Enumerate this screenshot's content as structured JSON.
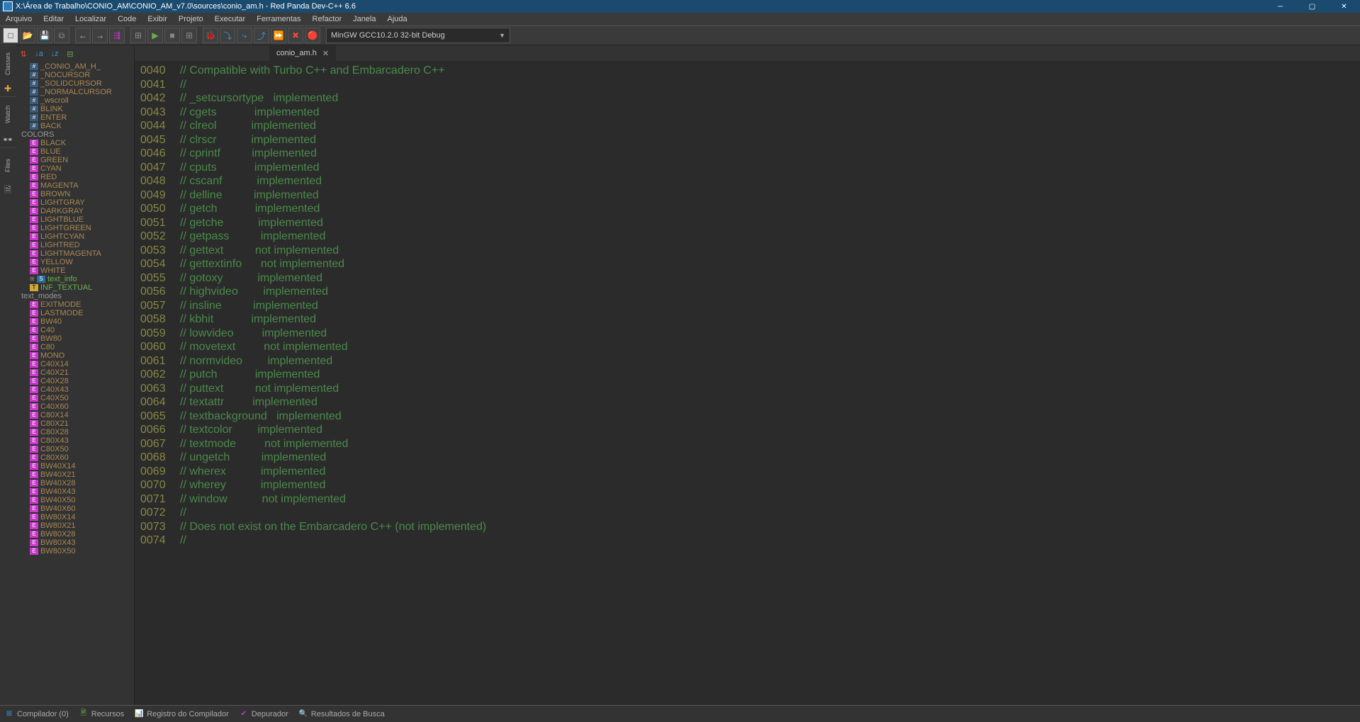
{
  "title": "X:\\Área de Trabalho\\CONIO_AM\\CONIO_AM_v7.0\\sources\\conio_am.h - Red Panda Dev-C++ 6.6",
  "menus": [
    "Arquivo",
    "Editar",
    "Localizar",
    "Code",
    "Exibir",
    "Projeto",
    "Executar",
    "Ferramentas",
    "Refactor",
    "Janela",
    "Ajuda"
  ],
  "compiler_combo": "MinGW GCC10.2.0 32-bit Debug",
  "vtabs": [
    "Classes",
    "Watch",
    "Files"
  ],
  "tree_defines": [
    " _CONIO_AM_H_",
    "_NOCURSOR",
    "_SOLIDCURSOR",
    "_NORMALCURSOR",
    "_wscroll",
    "BLINK",
    "ENTER",
    "BACK"
  ],
  "tree_enum_header": "COLORS",
  "tree_colors": [
    "BLACK",
    "BLUE",
    "GREEN",
    "CYAN",
    "RED",
    "MAGENTA",
    "BROWN",
    "LIGHTGRAY",
    "DARKGRAY",
    "LIGHTBLUE",
    "LIGHTGREEN",
    "LIGHTCYAN",
    "LIGHTRED",
    "LIGHTMAGENTA",
    "YELLOW",
    "WHITE"
  ],
  "tree_structs": [
    {
      "name": "text_info",
      "icon": "s",
      "expandable": true
    },
    {
      "name": "INF_TEXTUAL",
      "icon": "t",
      "expandable": false
    }
  ],
  "tree_textmodes_header": "text_modes",
  "tree_textmodes": [
    "EXITMODE",
    "LASTMODE",
    "BW40",
    "C40",
    "BW80",
    "C80",
    "MONO",
    "C40X14",
    "C40X21",
    "C40X28",
    "C40X43",
    "C40X50",
    "C40X60",
    "C80X14",
    "C80X21",
    "C80X28",
    "C80X43",
    "C80X50",
    "C80X60",
    "BW40X14",
    "BW40X21",
    "BW40X28",
    "BW40X43",
    "BW40X50",
    "BW40X60",
    "BW80X14",
    "BW80X21",
    "BW80X28",
    "BW80X43",
    "BW80X50"
  ],
  "tab_name": "conio_am.h",
  "code_lines": [
    {
      "n": "0040",
      "t": "// Compatible with Turbo C++ and Embarcadero C++"
    },
    {
      "n": "0041",
      "t": "//"
    },
    {
      "n": "0042",
      "t": "// _setcursortype   implemented"
    },
    {
      "n": "0043",
      "t": "// cgets            implemented"
    },
    {
      "n": "0044",
      "t": "// clreol           implemented"
    },
    {
      "n": "0045",
      "t": "// clrscr           implemented"
    },
    {
      "n": "0046",
      "t": "// cprintf          implemented"
    },
    {
      "n": "0047",
      "t": "// cputs            implemented"
    },
    {
      "n": "0048",
      "t": "// cscanf           implemented"
    },
    {
      "n": "0049",
      "t": "// delline          implemented"
    },
    {
      "n": "0050",
      "t": "// getch            implemented"
    },
    {
      "n": "0051",
      "t": "// getche           implemented"
    },
    {
      "n": "0052",
      "t": "// getpass          implemented"
    },
    {
      "n": "0053",
      "t": "// gettext          not implemented"
    },
    {
      "n": "0054",
      "t": "// gettextinfo      not implemented"
    },
    {
      "n": "0055",
      "t": "// gotoxy           implemented"
    },
    {
      "n": "0056",
      "t": "// highvideo        implemented"
    },
    {
      "n": "0057",
      "t": "// insline          implemented"
    },
    {
      "n": "0058",
      "t": "// kbhit            implemented"
    },
    {
      "n": "0059",
      "t": "// lowvideo         implemented"
    },
    {
      "n": "0060",
      "t": "// movetext         not implemented"
    },
    {
      "n": "0061",
      "t": "// normvideo        implemented"
    },
    {
      "n": "0062",
      "t": "// putch            implemented"
    },
    {
      "n": "0063",
      "t": "// puttext          not implemented"
    },
    {
      "n": "0064",
      "t": "// textattr         implemented"
    },
    {
      "n": "0065",
      "t": "// textbackground   implemented"
    },
    {
      "n": "0066",
      "t": "// textcolor        implemented"
    },
    {
      "n": "0067",
      "t": "// textmode         not implemented"
    },
    {
      "n": "0068",
      "t": "// ungetch          implemented"
    },
    {
      "n": "0069",
      "t": "// wherex           implemented"
    },
    {
      "n": "0070",
      "t": "// wherey           implemented"
    },
    {
      "n": "0071",
      "t": "// window           not implemented"
    },
    {
      "n": "0072",
      "t": "//"
    },
    {
      "n": "0073",
      "t": "// Does not exist on the Embarcadero C++ (not implemented)"
    },
    {
      "n": "0074",
      "t": "//"
    }
  ],
  "status": {
    "compiler": "Compilador (0)",
    "resources": "Recursos",
    "log": "Registro do Compilador",
    "debugger": "Depurador",
    "search": "Resultados de Busca"
  }
}
